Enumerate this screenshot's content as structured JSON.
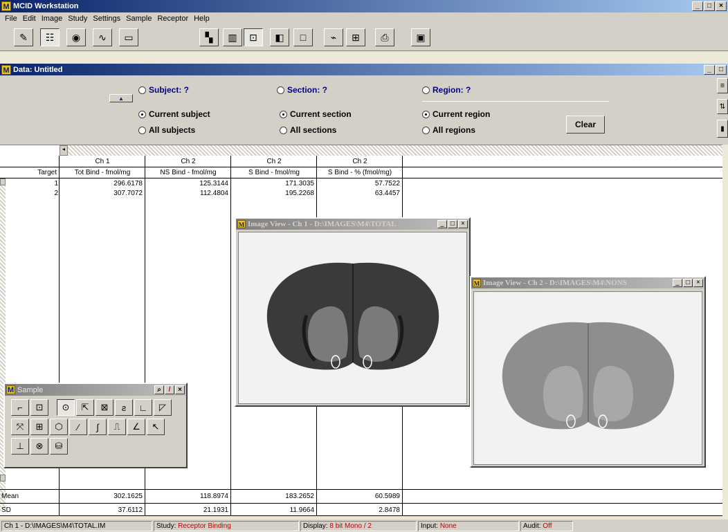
{
  "app": {
    "title": "MCID Workstation",
    "logo": "M"
  },
  "menu": [
    "File",
    "Edit",
    "Image",
    "Study",
    "Settings",
    "Sample",
    "Receptor",
    "Help"
  ],
  "toolbar_icons": [
    "ruler-icon",
    "grid-icon",
    "eye-icon",
    "curve-icon",
    "display-icon",
    "window-split-icon",
    "film-icon",
    "zoom-icon",
    "layout-icon",
    "square-icon",
    "graph-icon",
    "target-icon",
    "scanner-icon",
    "book-icon"
  ],
  "data_window": {
    "title": "Data: Untitled",
    "subject": {
      "label": "Subject: ?",
      "current": "Current subject",
      "all": "All subjects"
    },
    "section": {
      "label": "Section: ?",
      "current": "Current section",
      "all": "All sections"
    },
    "region": {
      "label": "Region: ?",
      "current": "Current region",
      "all": "All regions"
    },
    "clear_label": "Clear"
  },
  "table": {
    "channels": [
      "Ch 1",
      "Ch 2",
      "Ch 2",
      "Ch 2"
    ],
    "target_label": "Target",
    "headers": [
      "Tot Bind - fmol/mg",
      "NS Bind - fmol/mg",
      "S Bind - fmol/mg",
      "S Bind - % (fmol/mg)"
    ],
    "rows": [
      {
        "target": "1",
        "values": [
          "296.6178",
          "125.3144",
          "171.3035",
          "57.7522"
        ]
      },
      {
        "target": "2",
        "values": [
          "307.7072",
          "112.4804",
          "195.2268",
          "63.4457"
        ]
      }
    ],
    "mean": {
      "label": "Mean",
      "values": [
        "302.1625",
        "118.8974",
        "183.2652",
        "60.5989"
      ]
    },
    "sd": {
      "label": "SD",
      "values": [
        "37.6112",
        "21.1931",
        "11.9664",
        "2.8478"
      ]
    }
  },
  "image_view_1": {
    "title": "Image View - Ch 1 - D:\\IMAGES\\M4\\TOTAL"
  },
  "image_view_2": {
    "title": "Image View - Ch 2 - D:\\IMAGES\\M4\\NONS"
  },
  "sample": {
    "title": "Sample"
  },
  "status": {
    "path": "Ch 1 - D:\\IMAGES\\M4\\TOTAL.IM",
    "study_label": "Study: ",
    "study_value": "Receptor Binding",
    "display_label": "Display: ",
    "display_value": "8 bit Mono / 2",
    "input_label": "Input: ",
    "input_value": "None",
    "audit_label": "Audit: ",
    "audit_value": "Off"
  },
  "window_controls": {
    "min": "_",
    "max": "□",
    "close": "×"
  }
}
